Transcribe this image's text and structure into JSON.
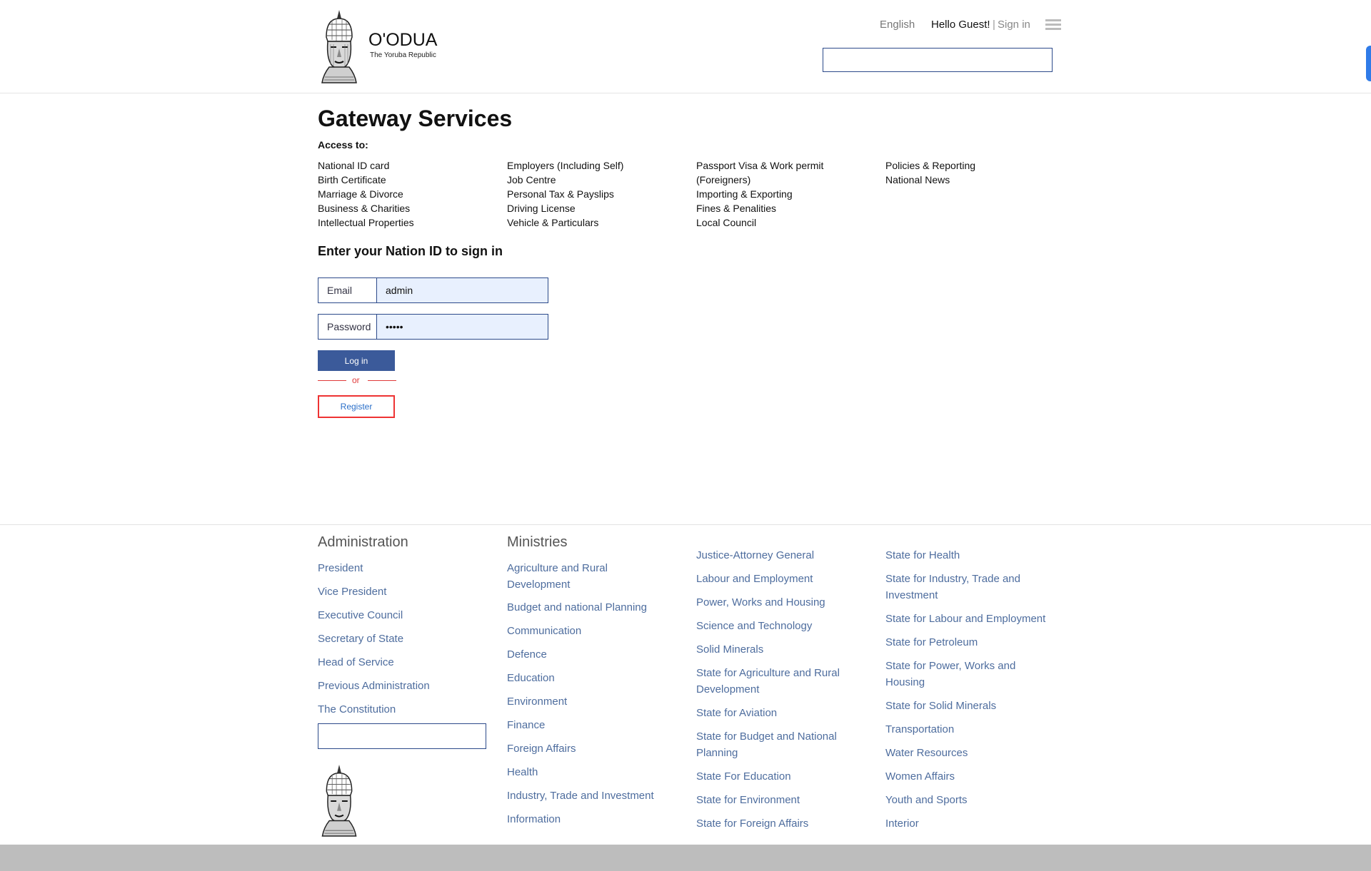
{
  "header": {
    "brand_name": "O'ODUA",
    "brand_tagline": "The Yoruba Republic",
    "language": "English",
    "greeting": "Hello Guest!",
    "separator": "|",
    "sign_in": "Sign in",
    "search_value": ""
  },
  "main": {
    "title": "Gateway Services",
    "access_label": "Access to:",
    "services": [
      [
        "National ID card",
        "Birth Certificate",
        "Marriage & Divorce",
        "Business & Charities",
        "Intellectual Properties"
      ],
      [
        "Employers (Including Self)",
        "Job Centre",
        "Personal Tax & Payslips",
        "Driving License",
        "Vehicle & Particulars"
      ],
      [
        "Passport Visa & Work permit",
        "(Foreigners)",
        "Importing & Exporting",
        "Fines & Penalities",
        "Local Council"
      ],
      [
        "Policies & Reporting",
        "National News"
      ]
    ],
    "signin_heading": "Enter your Nation ID to sign in",
    "email_label": "Email",
    "email_value": "admin",
    "password_label": "Password",
    "password_value": "•••••",
    "login_label": "Log in",
    "or_label": "or",
    "register_label": "Register"
  },
  "footer": {
    "admin_heading": "Administration",
    "admin_items": [
      "President",
      "Vice President",
      "Executive Council",
      "Secretary of State",
      "Head of Service",
      "Previous Administration",
      "The Constitution"
    ],
    "ministries_heading": "Ministries",
    "ministries_col1": [
      "Agriculture and Rural Development",
      "Budget and national Planning",
      "Communication",
      "Defence",
      "Education",
      "Environment",
      "Finance",
      "Foreign Affairs",
      "Health",
      "Industry, Trade and Investment",
      "Information"
    ],
    "ministries_col2": [
      "Justice-Attorney General",
      "Labour and Employment",
      "Power, Works and Housing",
      "Science and Technology",
      "Solid Minerals",
      "State for Agriculture and Rural Development",
      "State for Aviation",
      "State for Budget and National Planning",
      "State For Education",
      "State for Environment",
      "State for Foreign Affairs"
    ],
    "ministries_col3": [
      "State for Health",
      "State for Industry, Trade and Investment",
      "State for Labour and Employment",
      "State for Petroleum",
      "State for Power, Works and Housing",
      "State for Solid Minerals",
      "Transportation",
      "Water Resources",
      "Women Affairs",
      "Youth and Sports",
      "Interior"
    ],
    "search_value": ""
  },
  "colors": {
    "primary": "#3b5a9a",
    "link": "#4e6d9e",
    "accent_red": "#e03a3a",
    "side_tab": "#2f7be8",
    "bottom_bar": "#bdbdbd"
  },
  "icons": {
    "logo": "yoruba-bust-logo",
    "menu": "hamburger-menu-icon"
  }
}
